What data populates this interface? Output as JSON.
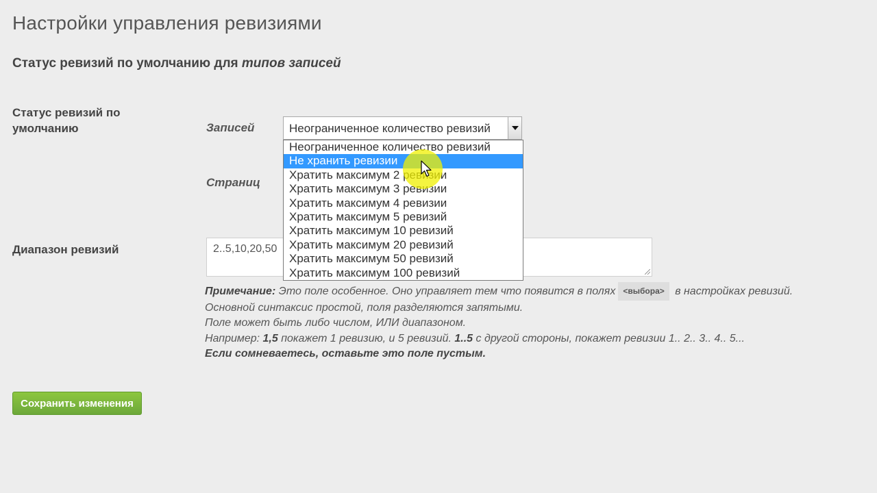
{
  "page": {
    "title": "Настройки управления ревизиями"
  },
  "section": {
    "title_plain": "Статус ревизий по умолчанию для ",
    "title_em": "типов записей"
  },
  "status_row": {
    "label": "Статус ревизий по умолчанию",
    "posts_label": "Записей",
    "pages_label": "Страниц",
    "posts_select_value": "Неограниченное количество ревизий",
    "options": [
      "Неограниченное количество ревизий",
      "Не хранить ревизии",
      "Хратить максимум 2 ревизии",
      "Хратить максимум 3 ревизии",
      "Хратить максимум 4 ревизии",
      "Хратить максимум 5 ревизий",
      "Хратить максимум 10 ревизий",
      "Хратить максимум 20 ревизий",
      "Хратить максимум 50 ревизий",
      "Хратить максимум 100 ревизий"
    ],
    "highlighted_option_index": 1
  },
  "range_row": {
    "label": "Диапазон ревизий",
    "value": "2..5,10,20,50"
  },
  "note": {
    "prefix": "Примечание:",
    "line1_text": " Это поле особенное. Оно управляет тем что появится в полях",
    "code_tag": "<выбора>",
    "line1_suffix": " в настройках ревизий.",
    "line2": "Основной синтаксис простой, поля разделяются запятыми.",
    "line3": "Поле может быть либо числом, ИЛИ диапазоном.",
    "line4_part1": "Например: ",
    "line4_bold1": "1,5",
    "line4_part2": " покажет 1 ревизию, и 5 ревизий. ",
    "line4_bold2": "1..5",
    "line4_part3": " с другой стороны, покажет ревизии 1.. 2.. 3.. 4.. 5...",
    "line5": "Если сомневаетесь, оставьте это поле пустым."
  },
  "actions": {
    "save_label": "Сохранить изменения"
  },
  "colors": {
    "background": "#ededed",
    "highlight": "#3399ff",
    "save_button": "#7ab83c",
    "cursor_highlight": "#f0f000"
  }
}
